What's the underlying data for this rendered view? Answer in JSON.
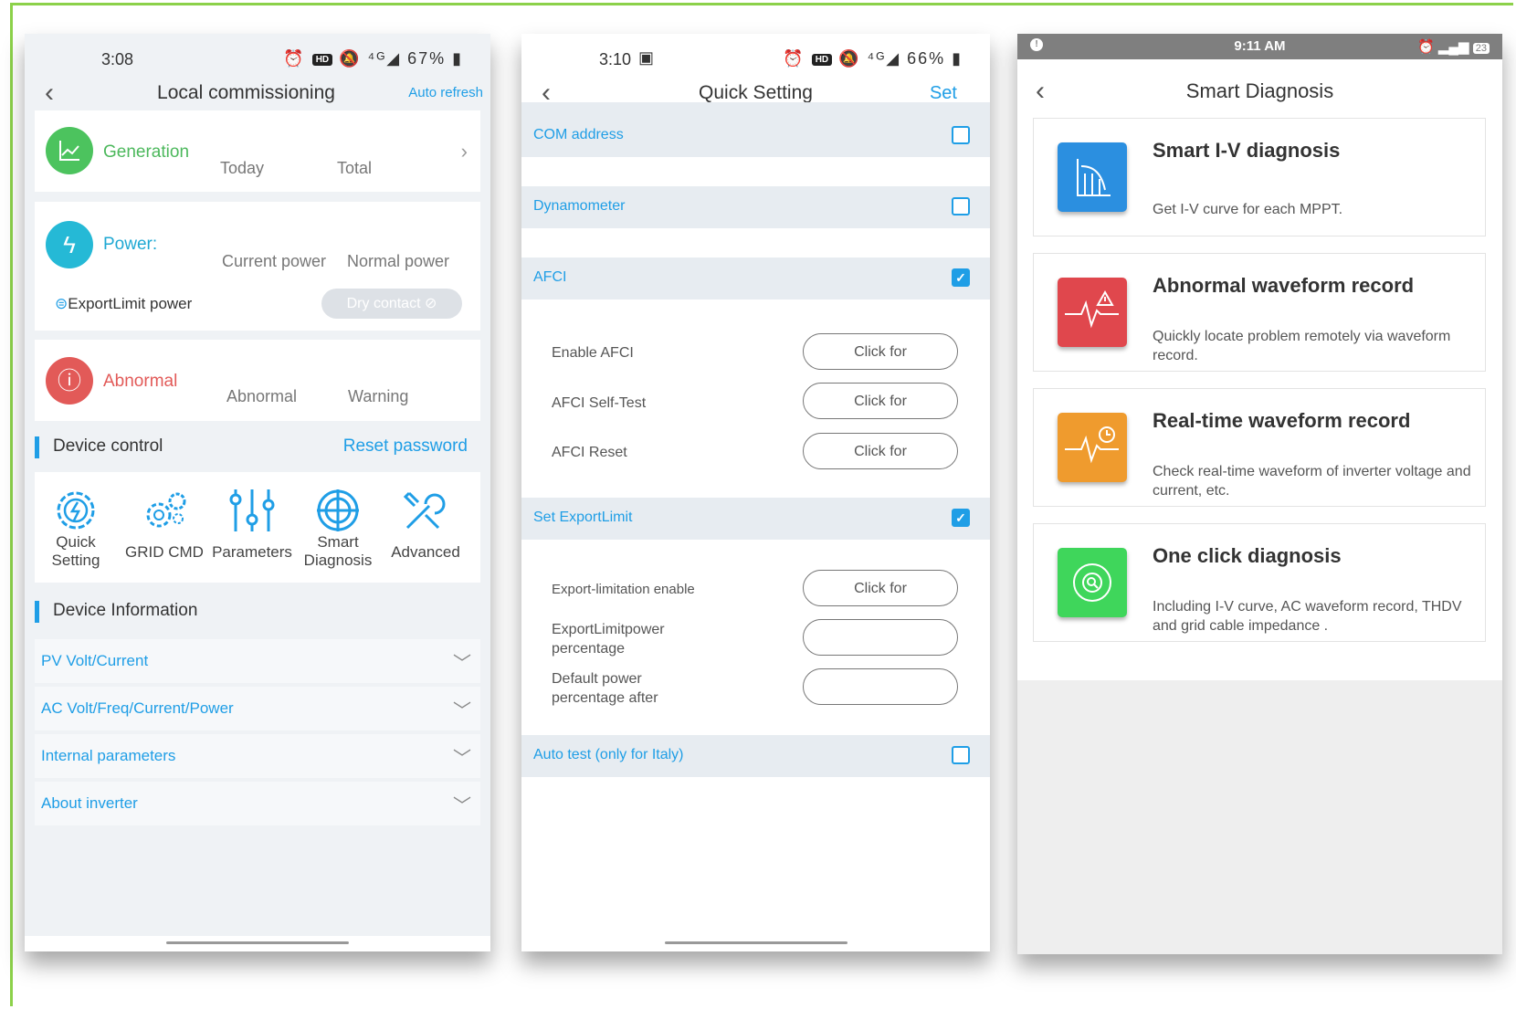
{
  "phone1": {
    "status": {
      "time": "3:08",
      "battery": "67%"
    },
    "nav": {
      "title": "Local commissioning",
      "action": "Auto refresh"
    },
    "generation": {
      "label": "Generation",
      "today": "Today",
      "total": "Total"
    },
    "power": {
      "label": "Power:",
      "current": "Current power",
      "normal": "Normal power",
      "export": "ExportLimit power",
      "dry": "Dry contact"
    },
    "abnormal": {
      "label": "Abnormal",
      "abnormal": "Abnormal",
      "warning": "Warning"
    },
    "device_control": {
      "title": "Device control",
      "reset": "Reset password"
    },
    "tools": {
      "quick": "Quick Setting",
      "grid": "GRID CMD",
      "params": "Parameters",
      "smart": "Smart Diagnosis",
      "advanced": "Advanced"
    },
    "device_info": {
      "title": "Device Information"
    },
    "accordion": [
      "PV Volt/Current",
      "AC Volt/Freq/Current/Power",
      "Internal parameters",
      "About inverter"
    ]
  },
  "phone2": {
    "status": {
      "time": "3:10",
      "battery": "66%"
    },
    "nav": {
      "title": "Quick Setting",
      "action": "Set"
    },
    "com": "COM address",
    "dyn": "Dynamometer",
    "afci": "AFCI",
    "afci_items": [
      "Enable AFCI",
      "AFCI Self-Test",
      "AFCI Reset"
    ],
    "click_for": "Click for",
    "export": "Set ExportLimit",
    "export_items": [
      "Export-limitation enable",
      "ExportLimitpower percentage",
      "Default power percentage after"
    ],
    "auto": "Auto test (only for Italy)"
  },
  "phone3": {
    "status": {
      "time": "9:11 AM",
      "badge": "23"
    },
    "nav": {
      "title": "Smart Diagnosis"
    },
    "cards": [
      {
        "title": "Smart I-V diagnosis",
        "desc": "Get I-V curve for each MPPT.",
        "color": "#2b8fe0"
      },
      {
        "title": "Abnormal waveform record",
        "desc": "Quickly locate problem remotely via waveform record.",
        "color": "#e0474d"
      },
      {
        "title": "Real-time waveform record",
        "desc": "Check real-time waveform of inverter voltage and current, etc.",
        "color": "#ef9b2e"
      },
      {
        "title": "One click diagnosis",
        "desc": "Including I-V curve, AC waveform record, THDV and grid cable impedance .",
        "color": "#3fd65b"
      }
    ]
  },
  "colors": {
    "accent": "#1f9ee6",
    "frame": "#8cd14a"
  }
}
